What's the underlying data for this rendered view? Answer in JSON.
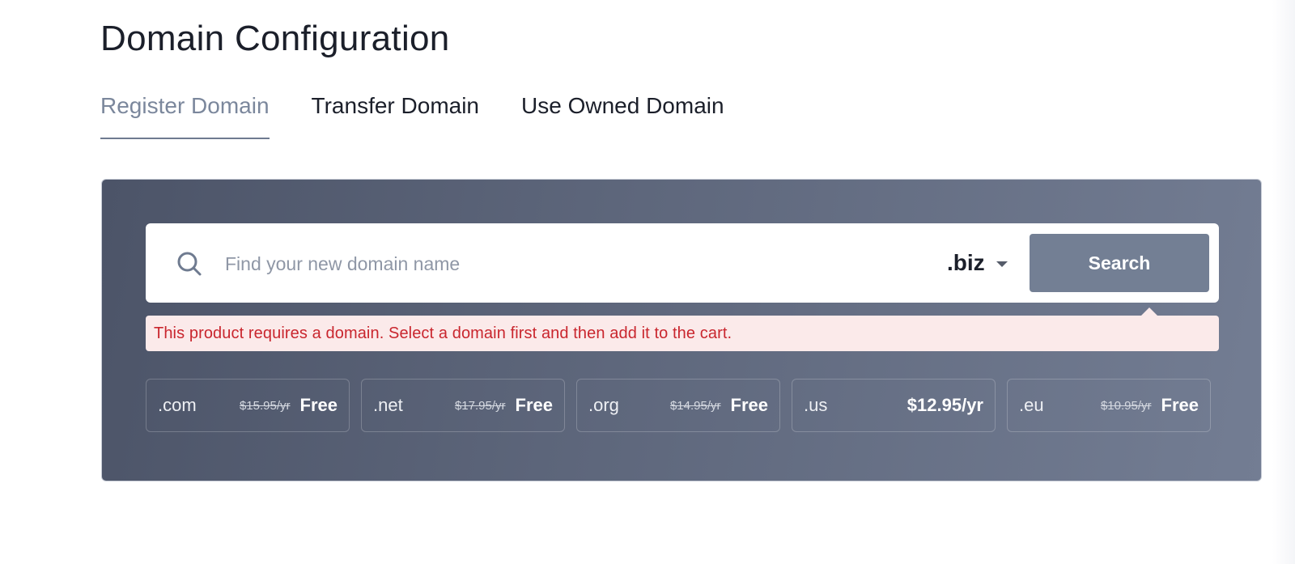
{
  "page": {
    "title": "Domain Configuration"
  },
  "tabs": [
    {
      "label": "Register Domain",
      "active": true
    },
    {
      "label": "Transfer Domain",
      "active": false
    },
    {
      "label": "Use Owned Domain",
      "active": false
    }
  ],
  "search": {
    "icon": "search-icon",
    "placeholder": "Find your new domain name",
    "value": "",
    "selected_tld": ".biz",
    "button_label": "Search"
  },
  "alert": {
    "message": "This product requires a domain. Select a domain first and then add it to the cart.",
    "color": "#c9262e"
  },
  "tld_options": [
    {
      "name": ".com",
      "old_price": "$15.95/yr",
      "price": "Free"
    },
    {
      "name": ".net",
      "old_price": "$17.95/yr",
      "price": "Free"
    },
    {
      "name": ".org",
      "old_price": "$14.95/yr",
      "price": "Free"
    },
    {
      "name": ".us",
      "old_price": "",
      "price": "$12.95/yr"
    },
    {
      "name": ".eu",
      "old_price": "$10.95/yr",
      "price": "Free"
    }
  ],
  "colors": {
    "accent": "#737f94",
    "panel_start": "#4c5468",
    "panel_end": "#737d93"
  }
}
